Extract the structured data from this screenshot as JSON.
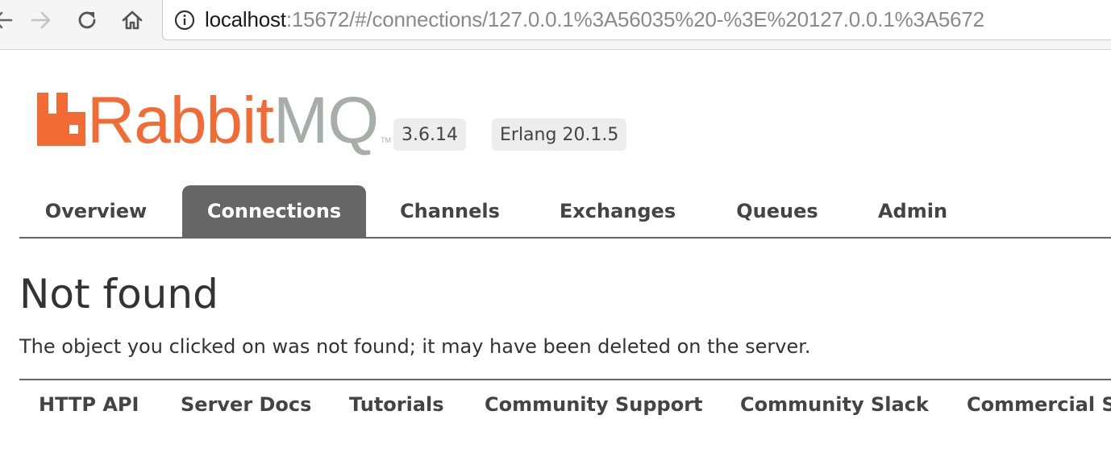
{
  "browser": {
    "url_host": "localhost",
    "url_rest": ":15672/#/connections/127.0.0.1%3A56035%20-%3E%20127.0.0.1%3A5672",
    "icons": {
      "back": "back-arrow-icon",
      "forward": "forward-arrow-icon",
      "reload": "reload-icon",
      "home": "home-icon",
      "info": "info-icon"
    }
  },
  "header": {
    "logo_rabbit": "Rabbit",
    "logo_mq": "MQ",
    "logo_tm": "TM",
    "version": "3.6.14",
    "erlang": "Erlang 20.1.5"
  },
  "tabs": [
    {
      "label": "Overview",
      "active": false
    },
    {
      "label": "Connections",
      "active": true
    },
    {
      "label": "Channels",
      "active": false
    },
    {
      "label": "Exchanges",
      "active": false
    },
    {
      "label": "Queues",
      "active": false
    },
    {
      "label": "Admin",
      "active": false
    }
  ],
  "main": {
    "title": "Not found",
    "message": "The object you clicked on was not found; it may have been deleted on the server."
  },
  "footer": {
    "links": [
      "HTTP API",
      "Server Docs",
      "Tutorials",
      "Community Support",
      "Community Slack",
      "Commercial Support"
    ]
  },
  "colors": {
    "brand_orange": "#f26b35",
    "brand_gray": "#a7ada9",
    "tab_active_bg": "#666666",
    "text": "#444444"
  }
}
